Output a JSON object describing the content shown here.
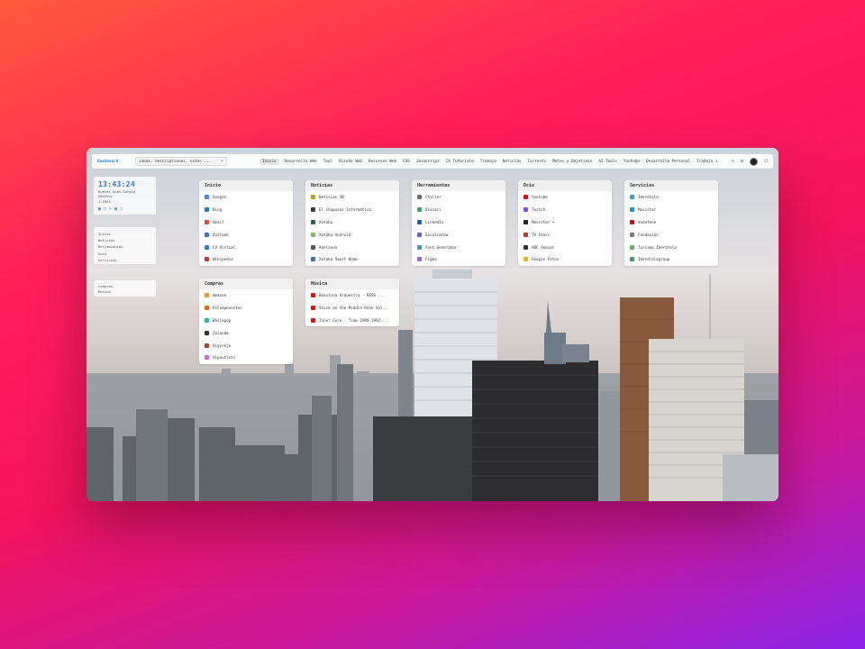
{
  "brand": "Dashboard",
  "search": {
    "value": "ideas, descripciones, notas ...",
    "icon": "search-icon"
  },
  "nav": [
    "Inicio",
    "Desarrollo Web",
    "Tool",
    "Diseño Web",
    "Recursos Web",
    "CSS",
    "Javascript",
    "IA Tutoriale",
    "Trabajo",
    "Noticias",
    "Torrents",
    "Metas y Objetivos",
    "AI Tools",
    "Youtube",
    "Desarrollo Personal",
    "Trabajo i"
  ],
  "nav_active_index": 0,
  "clock": {
    "time": "13:43:24",
    "greeting": "Buenas días Sergio Sánchez",
    "date": "1-2024"
  },
  "side_list1": [
    "Inicio",
    "Noticias",
    "Herramientas",
    "Ocio",
    "Servicios"
  ],
  "side_list2": [
    "Compras",
    "Música"
  ],
  "cards": [
    {
      "title": "Inicio",
      "items": [
        {
          "label": "Google",
          "color": "#4285f4"
        },
        {
          "label": "Bing",
          "color": "#0a84c4"
        },
        {
          "label": "Gmail",
          "color": "#ea4335"
        },
        {
          "label": "Outlook",
          "color": "#2f78d4"
        },
        {
          "label": "CV Virtual",
          "color": "#2a7be4"
        },
        {
          "label": "Wikipedia",
          "color": "#c0392b"
        }
      ]
    },
    {
      "title": "Noticias",
      "items": [
        {
          "label": "Noticias 3D",
          "color": "#c4a000"
        },
        {
          "label": "El Chapuzas Informático",
          "color": "#2c3e50"
        },
        {
          "label": "Xataka",
          "color": "#1f6b3a"
        },
        {
          "label": "Xataka Android",
          "color": "#78c257"
        },
        {
          "label": "Adslzone",
          "color": "#555555"
        },
        {
          "label": "Xataka Smart Home",
          "color": "#3a6fd8"
        }
      ]
    },
    {
      "title": "Herramientas",
      "items": [
        {
          "label": "Chiller",
          "color": "#6c6c6c"
        },
        {
          "label": "Diezari",
          "color": "#27ae60"
        },
        {
          "label": "LinkedIn",
          "color": "#0a66c2"
        },
        {
          "label": "Excalidraw",
          "color": "#6965db"
        },
        {
          "label": "Font Generator",
          "color": "#3498db"
        },
        {
          "label": "Figma",
          "color": "#a259ff"
        }
      ]
    },
    {
      "title": "Ocio",
      "items": [
        {
          "label": "Youtube",
          "color": "#ff0000"
        },
        {
          "label": "Twitch",
          "color": "#9146ff"
        },
        {
          "label": "Movistar +",
          "color": "#222222"
        },
        {
          "label": "TV Stars",
          "color": "#c0392b"
        },
        {
          "label": "ABC Senior",
          "color": "#333333"
        },
        {
          "label": "Google Fotos",
          "color": "#f4b400"
        }
      ]
    },
    {
      "title": "Servicios",
      "items": [
        {
          "label": "Iberdrola",
          "color": "#3aa0d8"
        },
        {
          "label": "Movistar",
          "color": "#019df4"
        },
        {
          "label": "Vodafone",
          "color": "#e60000"
        },
        {
          "label": "Fundación",
          "color": "#7a7a7a"
        },
        {
          "label": "Turismo Iberdrola",
          "color": "#5cb85c"
        },
        {
          "label": "Iberdrolagroup",
          "color": "#27ae60"
        }
      ]
    },
    {
      "title": "Compras",
      "items": [
        {
          "label": "Amazon",
          "color": "#ff9900"
        },
        {
          "label": "PcComponentes",
          "color": "#ff6000"
        },
        {
          "label": "Wallapop",
          "color": "#13c1ac"
        },
        {
          "label": "Zalando",
          "color": "#333333"
        },
        {
          "label": "Vigoréjo",
          "color": "#c0392b"
        },
        {
          "label": "Vipoutlets",
          "color": "#e056fd"
        }
      ]
    },
    {
      "title": "Música",
      "items": [
        {
          "label": "Boostina Orquestra - RESS ...",
          "color": "#ff0000"
        },
        {
          "label": "Stuck on the Middle Rock Vol...",
          "color": "#ff0000"
        },
        {
          "label": "Inner Core - Time 1990 1992...",
          "color": "#ff0000"
        }
      ]
    }
  ]
}
